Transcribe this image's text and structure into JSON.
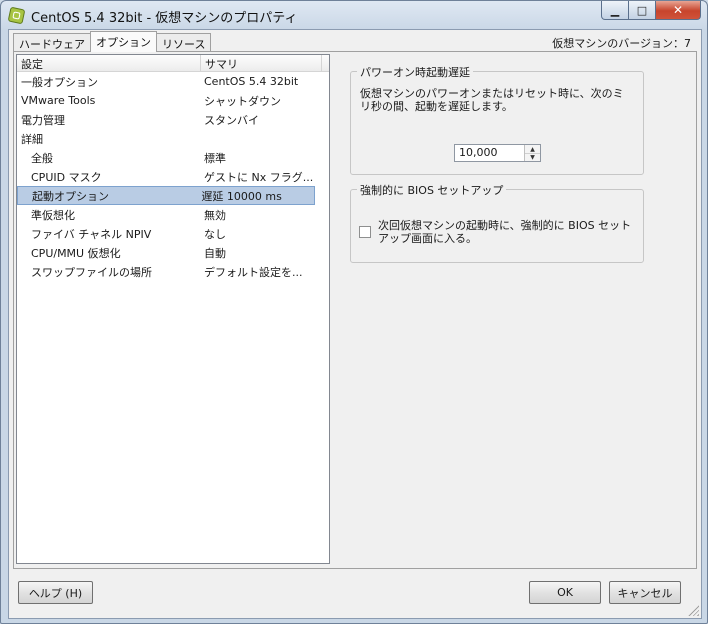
{
  "window": {
    "title": "CentOS 5.4 32bit - 仮想マシンのプロパティ",
    "minimize_glyph": "▁",
    "maximize_glyph": "□",
    "close_glyph": "✕"
  },
  "tabs": [
    {
      "label": "ハードウェア",
      "active": false
    },
    {
      "label": "オプション",
      "active": true
    },
    {
      "label": "リソース",
      "active": false
    }
  ],
  "version_label": "仮想マシンのバージョン：7",
  "list": {
    "headers": {
      "setting": "設定",
      "summary": "サマリ"
    },
    "rows": [
      {
        "setting": "一般オプション",
        "summary": "CentOS 5.4 32bit"
      },
      {
        "setting": "VMware Tools",
        "summary": "シャットダウン"
      },
      {
        "setting": "電力管理",
        "summary": "スタンバイ"
      },
      {
        "setting": "詳細",
        "summary": ""
      },
      {
        "setting": "全般",
        "summary": "標準"
      },
      {
        "setting": "CPUID マスク",
        "summary": "ゲストに Nx フラグ..."
      },
      {
        "setting": "起動オプション",
        "summary": "遅延 10000 ms"
      },
      {
        "setting": "準仮想化",
        "summary": "無効"
      },
      {
        "setting": "ファイバ チャネル NPIV",
        "summary": "なし"
      },
      {
        "setting": "CPU/MMU 仮想化",
        "summary": "自動"
      },
      {
        "setting": "スワップファイルの場所",
        "summary": "デフォルト設定を..."
      }
    ]
  },
  "power_on_delay": {
    "title": "パワーオン時起動遅延",
    "description": "仮想マシンのパワーオンまたはリセット時に、次のミリ秒の間、起動を遅延します。",
    "value": "10,000",
    "up_glyph": "▲",
    "down_glyph": "▼"
  },
  "force_bios": {
    "title": "強制的に BIOS セットアップ",
    "checkbox_label": "次回仮想マシンの起動時に、強制的に BIOS セットアップ画面に入る。",
    "checked": false
  },
  "buttons": {
    "help": "ヘルプ (H)",
    "ok": "OK",
    "cancel": "キャンセル"
  }
}
